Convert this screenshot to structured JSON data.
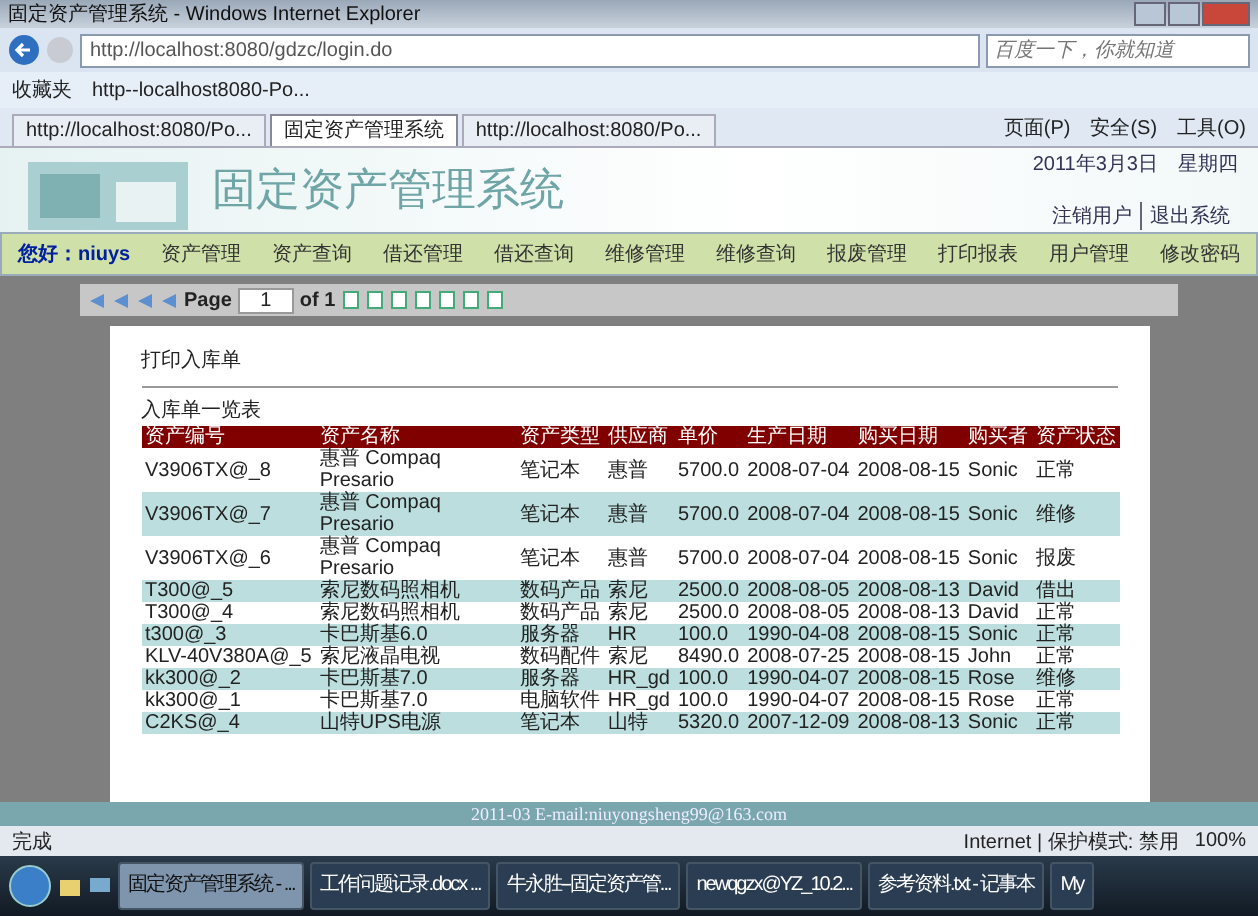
{
  "window": {
    "title": "固定资产管理系统 - Windows Internet Explorer"
  },
  "address_bar": {
    "url": "http://localhost:8080/gdzc/login.do",
    "search_placeholder": "百度一下，你就知道"
  },
  "favorites_bar": {
    "label": "收藏夹",
    "items": [
      "http--localhost8080-Po..."
    ]
  },
  "tabs": [
    {
      "label": "http://localhost:8080/Po...",
      "selected": false
    },
    {
      "label": "固定资产管理系统",
      "selected": true
    },
    {
      "label": "http://localhost:8080/Po...",
      "selected": false
    }
  ],
  "command_bar": [
    "页面(P)",
    "安全(S)",
    "工具(O)"
  ],
  "header": {
    "title": "固定资产管理系统",
    "date": "2011年3月3日",
    "weekday": "星期四",
    "links": [
      "注销用户",
      "退出系统"
    ]
  },
  "nav": {
    "greeting": "您好：niuys",
    "items": [
      "资产管理",
      "资产查询",
      "借还管理",
      "借还查询",
      "维修管理",
      "维修查询",
      "报废管理",
      "打印报表",
      "用户管理",
      "修改密码"
    ]
  },
  "report_toolbar": {
    "page_label": "Page",
    "page": "1",
    "of_label": "of 1"
  },
  "report": {
    "title": "打印入库单",
    "subtitle": "入库单一览表",
    "columns": [
      "资产编号",
      "资产名称",
      "资产类型",
      "供应商",
      "单价",
      "生产日期",
      "购买日期",
      "购买者",
      "资产状态"
    ],
    "rows": [
      [
        "V3906TX@_8",
        "惠普 Compaq Presario",
        "笔记本",
        "惠普",
        "5700.0",
        "2008-07-04",
        "2008-08-15",
        "Sonic",
        "正常"
      ],
      [
        "V3906TX@_7",
        "惠普 Compaq Presario",
        "笔记本",
        "惠普",
        "5700.0",
        "2008-07-04",
        "2008-08-15",
        "Sonic",
        "维修"
      ],
      [
        "V3906TX@_6",
        "惠普 Compaq Presario",
        "笔记本",
        "惠普",
        "5700.0",
        "2008-07-04",
        "2008-08-15",
        "Sonic",
        "报废"
      ],
      [
        "T300@_5",
        "索尼数码照相机",
        "数码产品",
        "索尼",
        "2500.0",
        "2008-08-05",
        "2008-08-13",
        "David",
        "借出"
      ],
      [
        "T300@_4",
        "索尼数码照相机",
        "数码产品",
        "索尼",
        "2500.0",
        "2008-08-05",
        "2008-08-13",
        "David",
        "正常"
      ],
      [
        "t300@_3",
        "卡巴斯基6.0",
        "服务器",
        "HR",
        "100.0",
        "1990-04-08",
        "2008-08-15",
        "Sonic",
        "正常"
      ],
      [
        "KLV-40V380A@_5",
        "索尼液晶电视",
        "数码配件",
        "索尼",
        "8490.0",
        "2008-07-25",
        "2008-08-15",
        "John",
        "正常"
      ],
      [
        "kk300@_2",
        "卡巴斯基7.0",
        "服务器",
        "HR_gd",
        "100.0",
        "1990-04-07",
        "2008-08-15",
        "Rose",
        "维修"
      ],
      [
        "kk300@_1",
        "卡巴斯基7.0",
        "电脑软件",
        "HR_gd",
        "100.0",
        "1990-04-07",
        "2008-08-15",
        "Rose",
        "正常"
      ],
      [
        "C2KS@_4",
        "山特UPS电源",
        "笔记本",
        "山特",
        "5320.0",
        "2007-12-09",
        "2008-08-13",
        "Sonic",
        "正常"
      ]
    ]
  },
  "footer": "2011-03 E-mail:niuyongsheng99@163.com",
  "status_bar": {
    "status": "完成",
    "zone": "Internet | 保护模式: 禁用",
    "zoom": "100%"
  },
  "taskbar": {
    "tasks": [
      {
        "label": "固定资产管理系统 - ...",
        "selected": true
      },
      {
        "label": "工作问题记录.docx ...",
        "selected": false
      },
      {
        "label": "牛永胜--固定资产管...",
        "selected": false
      },
      {
        "label": "newqgzx@YZ_10.2...",
        "selected": false
      },
      {
        "label": "参考资料.txt - 记事本",
        "selected": false
      },
      {
        "label": "My",
        "selected": false
      }
    ]
  }
}
